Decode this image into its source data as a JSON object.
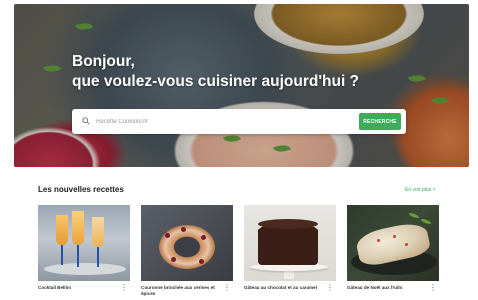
{
  "hero": {
    "title_line1": "Bonjour,",
    "title_line2": "que voulez-vous cuisiner aujourd'hui ?",
    "search_placeholder": "Recette Cookidoo®",
    "search_button": "RECHERCHE"
  },
  "section": {
    "title": "Les nouvelles recettes",
    "see_more": "En voir plus >"
  },
  "recipes": [
    {
      "title": "Cocktail Bellini",
      "more": "⋮"
    },
    {
      "title": "Couronne briochée aux cerises et épices",
      "more": "⋮"
    },
    {
      "title": "Gâteau au chocolat et au caramel",
      "more": "⋮"
    },
    {
      "title": "Gâteau de Noël aux fruits",
      "more": "⋮"
    }
  ],
  "colors": {
    "accent": "#3faa5a"
  }
}
